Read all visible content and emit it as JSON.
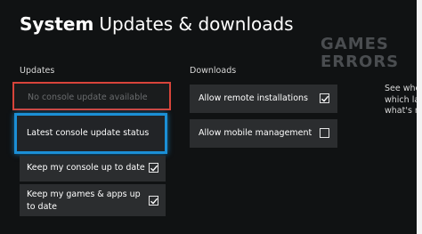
{
  "header": {
    "system": "System",
    "subtitle": "Updates & downloads"
  },
  "watermark": {
    "line1": "GAMES",
    "line2": "ERRORS"
  },
  "updates": {
    "section_label": "Updates",
    "no_update": "No console update available",
    "latest_status": "Latest console update status",
    "keep_console": {
      "label": "Keep my console up to date",
      "checked": true
    },
    "keep_games": {
      "label_line1": "Keep my games & apps up",
      "label_line2": "to date",
      "checked": true
    }
  },
  "downloads": {
    "section_label": "Downloads",
    "remote": {
      "label": "Allow remote installations",
      "checked": true
    },
    "mobile": {
      "label": "Allow mobile management",
      "checked": false
    }
  },
  "side_text": {
    "line1": "See whe",
    "line2": "which la",
    "line3": "what's n"
  },
  "colors": {
    "background": "#101213",
    "tile": "#2b2d2f",
    "focus_border": "#1b8fd6",
    "highlight_border": "#d8443a"
  }
}
